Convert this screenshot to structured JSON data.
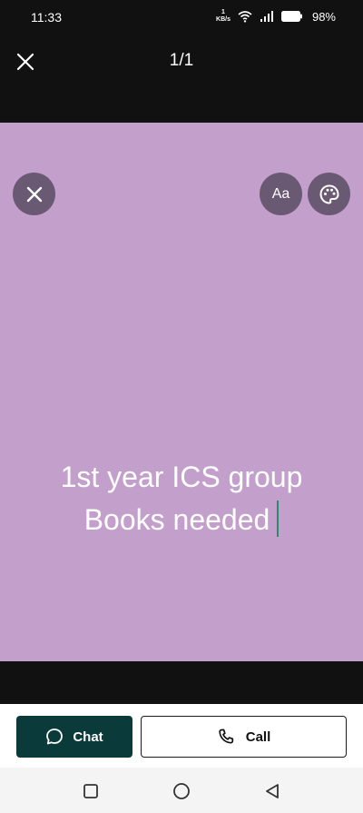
{
  "status_bar": {
    "time": "11:33",
    "speed_value": "1",
    "speed_unit": "KB/s",
    "battery": "98%"
  },
  "header": {
    "counter": "1/1"
  },
  "preview": {
    "background_color": "#c39fcb",
    "font_button_label": "Aa",
    "text_line_1": "1st year ICS group",
    "text_line_2": "Books needed"
  },
  "actions": {
    "chat_label": "Chat",
    "call_label": "Call"
  },
  "icons": {
    "close": "close-icon",
    "discard": "close-icon",
    "palette": "palette-icon",
    "chat": "chat-bubble-icon",
    "call": "phone-icon",
    "nav_recents": "square-icon",
    "nav_home": "circle-icon",
    "nav_back": "triangle-back-icon"
  }
}
